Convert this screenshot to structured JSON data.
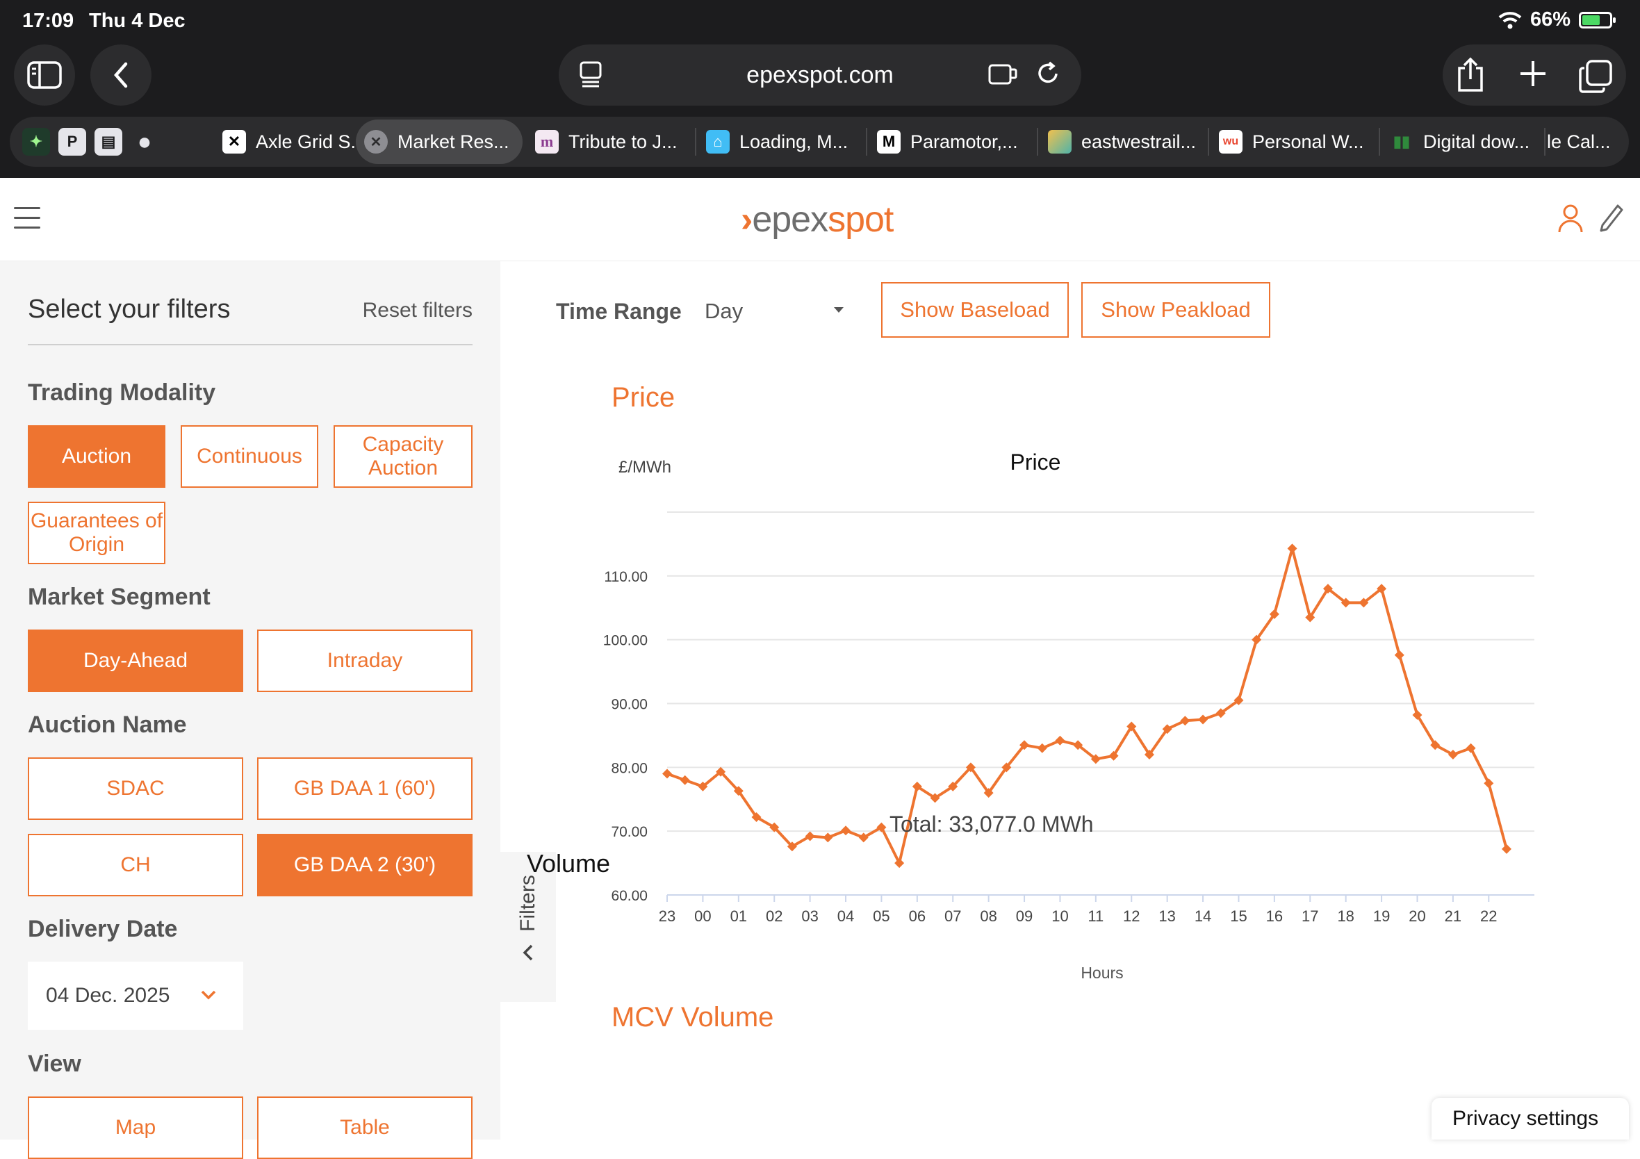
{
  "statusbar": {
    "time": "17:09",
    "date": "Thu 4 Dec",
    "battery": "66%",
    "battery_level": 0.66
  },
  "browser": {
    "url": "epexspot.com",
    "pinned": [
      "octopus-energy",
      "P",
      "notes",
      "github"
    ],
    "tabs": [
      {
        "label": "Axle Grid S...",
        "icon": "x-logo-icon"
      },
      {
        "label": "Market Res...",
        "icon": "close-icon",
        "active": true
      },
      {
        "label": "Tribute to J...",
        "icon": "m-logo-icon"
      },
      {
        "label": "Loading, M...",
        "icon": "home-assistant-icon"
      },
      {
        "label": "Paramotor,...",
        "icon": "m-logo-icon"
      },
      {
        "label": "eastwestrail...",
        "icon": "map-icon"
      },
      {
        "label": "Personal W...",
        "icon": "wu-icon"
      },
      {
        "label": "Digital dow...",
        "icon": "waveform-icon"
      },
      {
        "label": "le Cal...",
        "icon": ""
      }
    ]
  },
  "header": {
    "logo_a": "epex",
    "logo_b": "spot",
    "brand_color": "#ee7430"
  },
  "sidebar": {
    "title": "Select your filters",
    "reset": "Reset filters",
    "trading_modality": {
      "label": "Trading Modality",
      "options": [
        "Auction",
        "Continuous",
        "Capacity Auction",
        "Guarantees of Origin"
      ],
      "selected": "Auction"
    },
    "market_segment": {
      "label": "Market Segment",
      "options": [
        "Day-Ahead",
        "Intraday"
      ],
      "selected": "Day-Ahead"
    },
    "auction_name": {
      "label": "Auction Name",
      "options": [
        "SDAC",
        "GB DAA 1 (60')",
        "CH",
        "GB DAA 2 (30')"
      ],
      "selected": "GB DAA 2 (30')"
    },
    "delivery_date": {
      "label": "Delivery Date",
      "value": "04 Dec. 2025"
    },
    "view": {
      "label": "View",
      "options": [
        "Map",
        "Table"
      ]
    },
    "toggle": "Filters"
  },
  "main": {
    "time_range": {
      "label": "Time Range",
      "value": "Day"
    },
    "show_baseload": "Show Baseload",
    "show_peakload": "Show Peakload",
    "price_heading": "Price",
    "volume_heading": "MCV Volume",
    "total": "Total: 33,077.0 MWh",
    "volume_chart_title": "Volume"
  },
  "privacy": "Privacy settings",
  "chart_data": {
    "type": "line",
    "title": "Price",
    "xlabel": "Hours",
    "ylabel": "£/MWh",
    "ylim": [
      60,
      120
    ],
    "y_ticks": [
      "60.00",
      "70.00",
      "80.00",
      "90.00",
      "100.00",
      "110.00"
    ],
    "x_ticks": [
      "23",
      "00",
      "01",
      "02",
      "03",
      "04",
      "05",
      "06",
      "07",
      "08",
      "09",
      "10",
      "11",
      "12",
      "13",
      "14",
      "15",
      "16",
      "17",
      "18",
      "19",
      "20",
      "21",
      "22"
    ],
    "grid": true,
    "legend": "none",
    "series": [
      {
        "color": "#ee7430",
        "values": [
          79.0,
          78.0,
          77.0,
          79.3,
          76.3,
          72.2,
          70.6,
          67.6,
          69.2,
          69.0,
          70.1,
          69.0,
          70.6,
          65.0,
          77.0,
          75.2,
          77.0,
          80.0,
          76.0,
          80.0,
          83.5,
          83.0,
          84.2,
          83.5,
          81.3,
          81.8,
          86.4,
          82.0,
          86.0,
          87.3,
          87.5,
          88.5,
          90.5,
          100.0,
          104.0,
          114.3,
          103.5,
          108.0,
          105.8,
          105.8,
          108.0,
          97.6,
          88.2,
          83.5,
          82.0,
          83.0,
          77.5,
          67.2
        ]
      }
    ]
  }
}
